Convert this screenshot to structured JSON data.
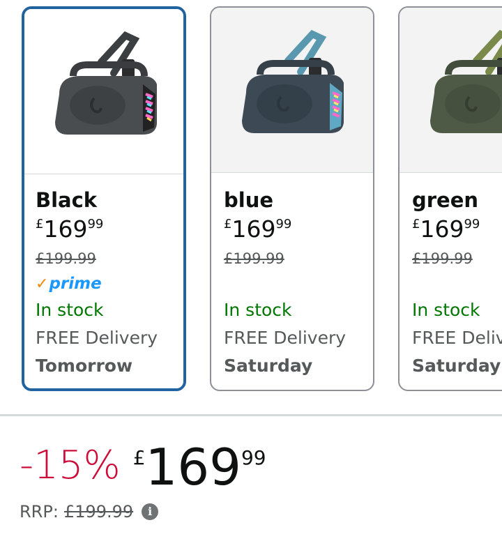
{
  "variants": [
    {
      "name": "Black",
      "currency": "£",
      "price_whole": "169",
      "price_fraction": "99",
      "rrp": "£199.99",
      "prime": "prime",
      "stock": "In stock",
      "delivery": "FREE Delivery",
      "day": "Tomorrow",
      "strap_color": "#3c3f42",
      "body_color": "#4a4d50",
      "selected": true
    },
    {
      "name": "blue",
      "currency": "£",
      "price_whole": "169",
      "price_fraction": "99",
      "rrp": "£199.99",
      "prime": "",
      "stock": "In stock",
      "delivery": "FREE Delivery",
      "day": "Saturday",
      "strap_color": "#5a98b0",
      "body_color": "#3d4a55",
      "selected": false
    },
    {
      "name": "green",
      "currency": "£",
      "price_whole": "169",
      "price_fraction": "99",
      "rrp": "£199.99",
      "prime": "",
      "stock": "In stock",
      "delivery": "FREE Delivery",
      "day": "Saturday",
      "strap_color": "#7a8a4a",
      "body_color": "#4e5a45",
      "selected": false
    }
  ],
  "summary": {
    "discount": "-15%",
    "currency": "£",
    "price_whole": "169",
    "price_fraction": "99",
    "rrp_label": "RRP:",
    "rrp_value": "£199.99",
    "info_icon": "i"
  },
  "icons": {
    "prime_check": "check-icon",
    "info": "info-icon"
  }
}
